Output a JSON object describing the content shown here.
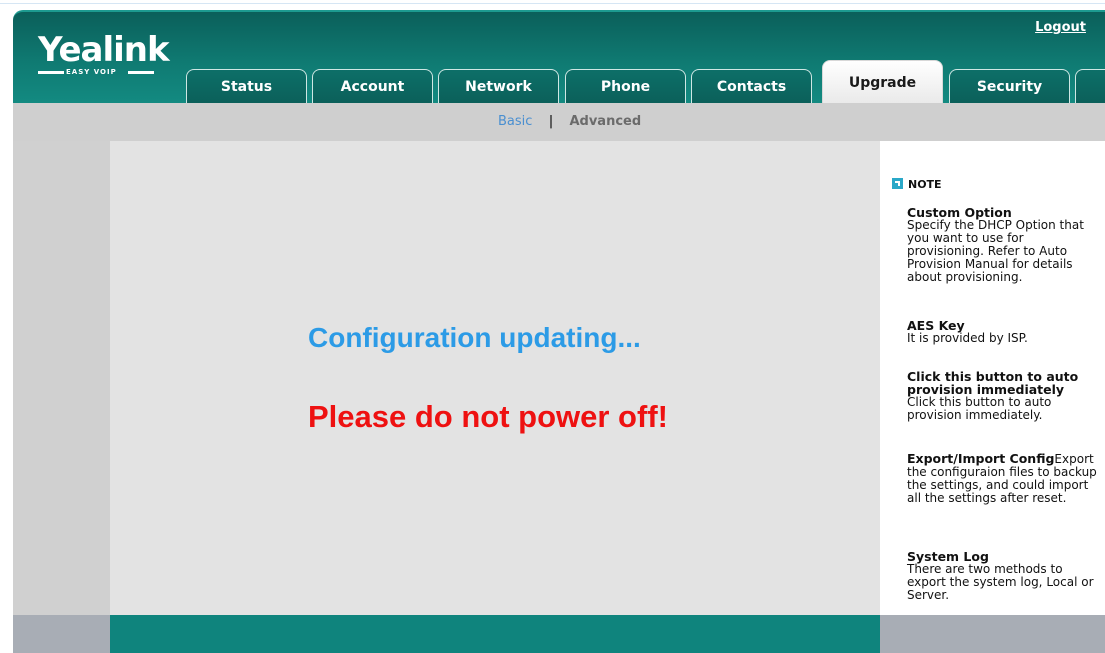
{
  "header": {
    "logo_text": "Yealink",
    "logo_tagline": "EASY VOIP",
    "logout_label": "Logout"
  },
  "tabs": [
    {
      "label": "Status",
      "active": false
    },
    {
      "label": "Account",
      "active": false
    },
    {
      "label": "Network",
      "active": false
    },
    {
      "label": "Phone",
      "active": false
    },
    {
      "label": "Contacts",
      "active": false
    },
    {
      "label": "Upgrade",
      "active": true
    },
    {
      "label": "Security",
      "active": false
    }
  ],
  "subnav": {
    "basic_label": "Basic",
    "separator": "|",
    "advanced_label": "Advanced",
    "current": "Advanced"
  },
  "main": {
    "message_updating": "Configuration updating...",
    "message_warning": "Please do not power off!"
  },
  "note": {
    "header": "NOTE",
    "items": [
      {
        "title": "Custom Option",
        "body": "Specify the DHCP Option that you want to use for provisioning. Refer to Auto Provision Manual for details about provisioning."
      },
      {
        "title": "AES Key",
        "body": "It is provided by ISP."
      },
      {
        "title": "Click this button to auto provision immediately",
        "body": "Click this button to auto provision immediately."
      },
      {
        "title": "Export/Import Config",
        "body": "Export the configuraion files to backup the settings, and could import all the settings after reset."
      },
      {
        "title": "System Log",
        "body": "There are two methods to export the system log, Local or Server."
      }
    ]
  },
  "colors": {
    "brand_teal": "#0f7a72",
    "updating_blue": "#2c9be6",
    "warning_red": "#ee1111"
  }
}
